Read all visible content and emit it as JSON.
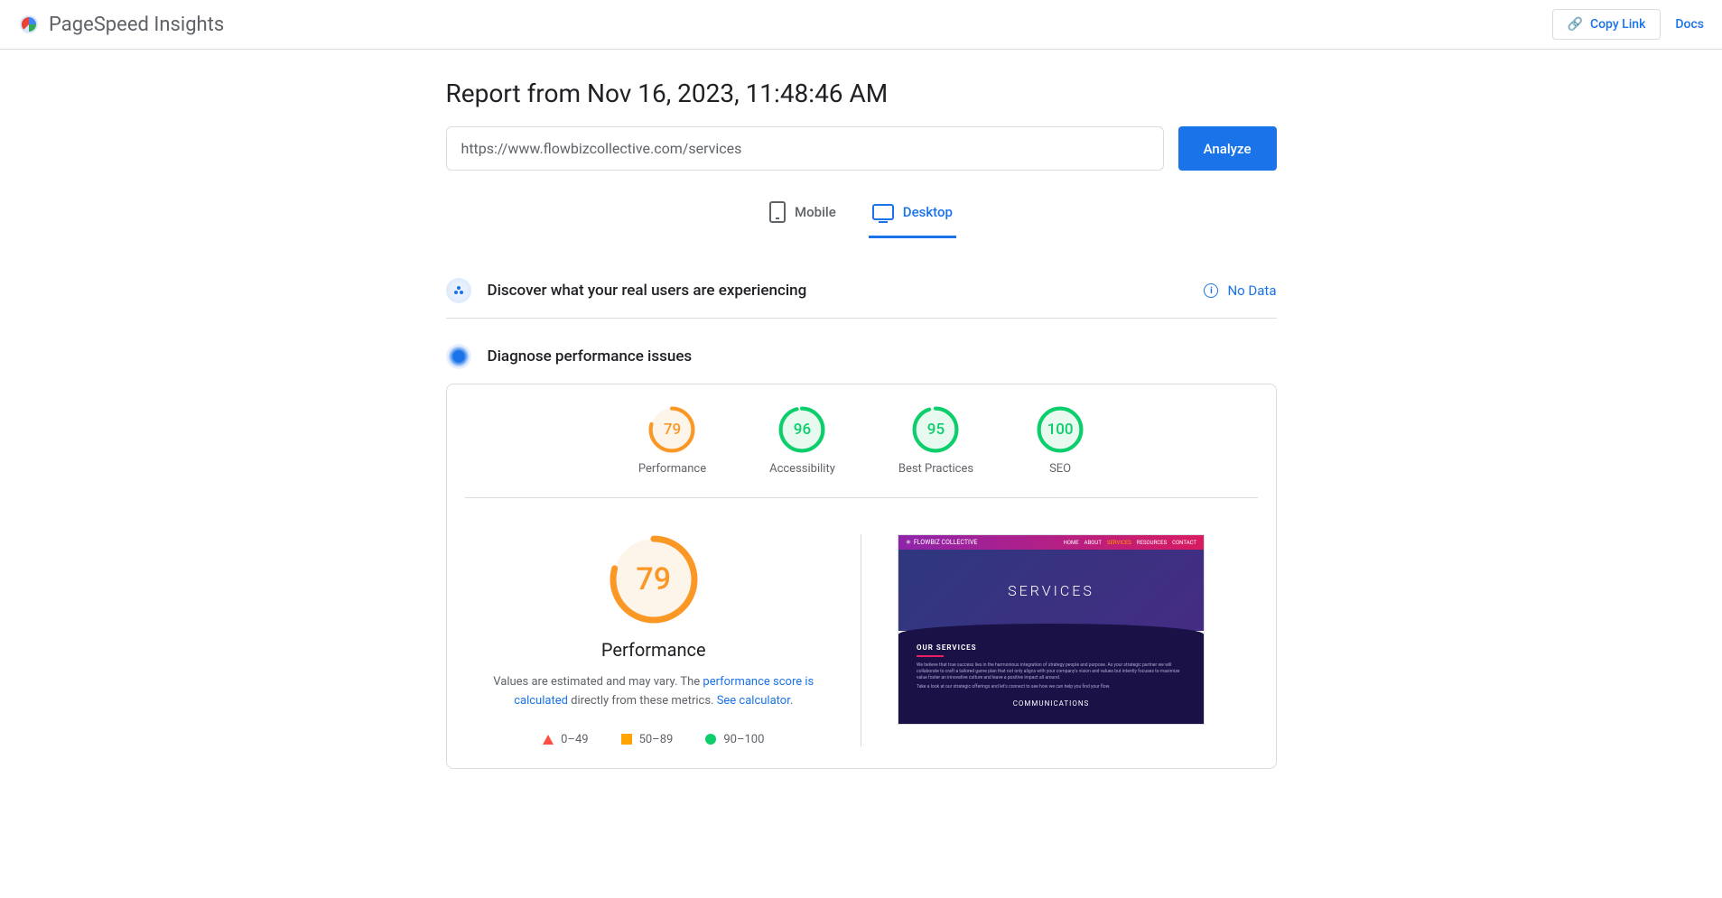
{
  "header": {
    "app_title": "PageSpeed Insights",
    "copy_link": "Copy Link",
    "docs": "Docs"
  },
  "report": {
    "title": "Report from Nov 16, 2023, 11:48:46 AM",
    "url": "https://www.flowbizcollective.com/services",
    "analyze": "Analyze"
  },
  "tabs": {
    "mobile": "Mobile",
    "desktop": "Desktop"
  },
  "crux": {
    "title": "Discover what your real users are experiencing",
    "no_data": "No Data"
  },
  "diag": {
    "title": "Diagnose performance issues"
  },
  "scores": [
    {
      "value": "79",
      "label": "Performance",
      "color": "orange",
      "pct": 79
    },
    {
      "value": "96",
      "label": "Accessibility",
      "color": "green",
      "pct": 96
    },
    {
      "value": "95",
      "label": "Best Practices",
      "color": "green",
      "pct": 95
    },
    {
      "value": "100",
      "label": "SEO",
      "color": "green",
      "pct": 100
    }
  ],
  "detail": {
    "value": "79",
    "label": "Performance",
    "disclaimer_prefix": "Values are estimated and may vary. The ",
    "disclaimer_link1": "performance score is calculated",
    "disclaimer_mid": " directly from these metrics. ",
    "disclaimer_link2": "See calculator",
    "disclaimer_suffix": "."
  },
  "legend": {
    "red": "0–49",
    "orange": "50–89",
    "green": "90–100"
  },
  "screenshot": {
    "brand": "FLOWBIZ COLLECTIVE",
    "nav": [
      "HOME",
      "ABOUT",
      "SERVICES",
      "RESOURCES",
      "CONTACT"
    ],
    "hero": "SERVICES",
    "section": "OUR SERVICES",
    "p1": "We believe that true success lies in the harmonious integration of strategy people and purpose. As your strategic partner we will collaborate to craft a tailored game plan that not only aligns with your company's vision and values but intently focuses to maximize value foster an innovative culture and leave a positive impact all around.",
    "p2": "Take a look at our strategic offerings and let's connect to see how we can help you find your flow.",
    "comm": "COMMUNICATIONS"
  }
}
